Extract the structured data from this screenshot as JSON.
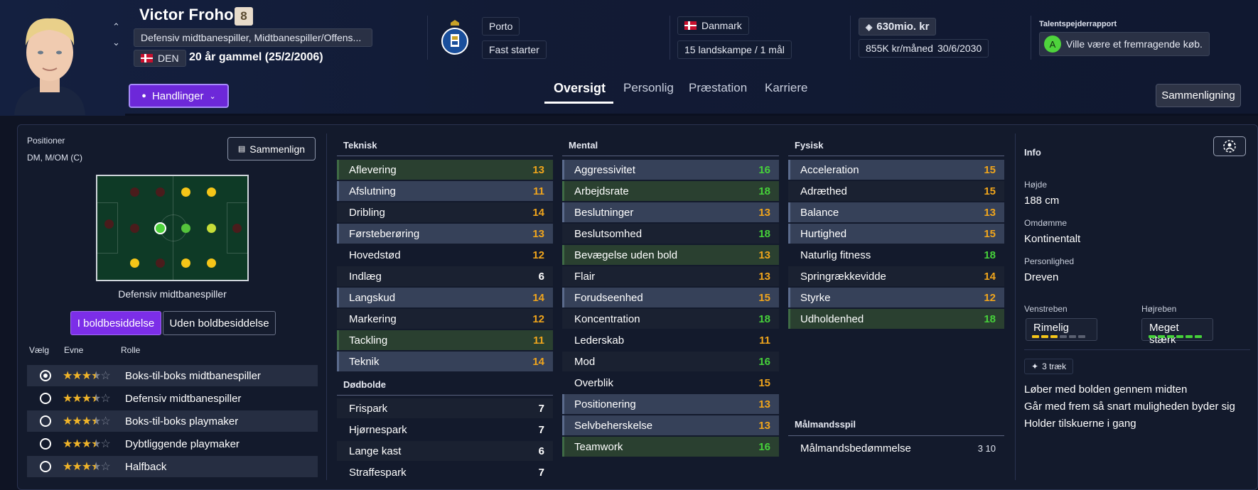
{
  "player": {
    "name": "Victor Froholdt",
    "squad_number": "8",
    "positions_text": "Defensiv midtbanespiller, Midtbanespiller/Offens...",
    "nationality_code": "DEN",
    "age_text": "20 år gammel (25/2/2006)"
  },
  "club": {
    "name": "Porto",
    "status": "Fast starter"
  },
  "nation": {
    "name": "Danmark",
    "caps": "15 landskampe / 1 mål"
  },
  "contract": {
    "value": "630mio. kr",
    "wage": "855K kr/måned",
    "expires": "30/6/2030"
  },
  "scout": {
    "title": "Talentspejderrapport",
    "grade": "A",
    "text": "Ville være et fremragende køb."
  },
  "actions_label": "Handlinger",
  "tabs": [
    {
      "label": "Oversigt",
      "active": true
    },
    {
      "label": "Personlig"
    },
    {
      "label": "Præstation"
    },
    {
      "label": "Karriere"
    }
  ],
  "compare_top_label": "Sammenligning",
  "positions": {
    "label": "Positioner",
    "value": "DM, M/OM (C)",
    "compare_label": "Sammenlign",
    "role_title": "Defensiv midtbanespiller",
    "toggle_on": "I boldbesiddelse",
    "toggle_off": "Uden boldbesiddelse"
  },
  "role_table": {
    "headers": [
      "Vælg",
      "Evne",
      "Rolle"
    ],
    "rows": [
      {
        "name": "Boks-til-boks midtbanespiller",
        "stars": 3.5,
        "selected": true
      },
      {
        "name": "Defensiv midtbanespiller",
        "stars": 3.5
      },
      {
        "name": "Boks-til-boks playmaker",
        "stars": 3.5
      },
      {
        "name": "Dybtliggende playmaker",
        "stars": 3.5
      },
      {
        "name": "Halfback",
        "stars": 3.5
      }
    ]
  },
  "teknisk": {
    "title": "Teknisk",
    "items": [
      {
        "name": "Aflevering",
        "value": "13"
      },
      {
        "name": "Afslutning",
        "value": "11"
      },
      {
        "name": "Dribling",
        "value": "14"
      },
      {
        "name": "Førsteberøring",
        "value": "13"
      },
      {
        "name": "Hovedstød",
        "value": "12"
      },
      {
        "name": "Indlæg",
        "value": "6"
      },
      {
        "name": "Langskud",
        "value": "14"
      },
      {
        "name": "Markering",
        "value": "12"
      },
      {
        "name": "Tackling",
        "value": "11"
      },
      {
        "name": "Teknik",
        "value": "14"
      }
    ]
  },
  "doedbolde": {
    "title": "Dødbolde",
    "items": [
      {
        "name": "Frispark",
        "value": "7"
      },
      {
        "name": "Hjørnespark",
        "value": "7"
      },
      {
        "name": "Lange kast",
        "value": "6"
      },
      {
        "name": "Straffespark",
        "value": "7"
      }
    ]
  },
  "mental": {
    "title": "Mental",
    "items": [
      {
        "name": "Aggressivitet",
        "value": "16"
      },
      {
        "name": "Arbejdsrate",
        "value": "18"
      },
      {
        "name": "Beslutninger",
        "value": "13"
      },
      {
        "name": "Beslutsomhed",
        "value": "18"
      },
      {
        "name": "Bevægelse uden bold",
        "value": "13"
      },
      {
        "name": "Flair",
        "value": "13"
      },
      {
        "name": "Forudseenhed",
        "value": "15"
      },
      {
        "name": "Koncentration",
        "value": "18"
      },
      {
        "name": "Lederskab",
        "value": "11"
      },
      {
        "name": "Mod",
        "value": "16"
      },
      {
        "name": "Overblik",
        "value": "15"
      },
      {
        "name": "Positionering",
        "value": "13"
      },
      {
        "name": "Selvbeherskelse",
        "value": "13"
      },
      {
        "name": "Teamwork",
        "value": "16"
      }
    ]
  },
  "fysisk": {
    "title": "Fysisk",
    "items": [
      {
        "name": "Acceleration",
        "value": "15"
      },
      {
        "name": "Adræthed",
        "value": "15"
      },
      {
        "name": "Balance",
        "value": "13"
      },
      {
        "name": "Hurtighed",
        "value": "15"
      },
      {
        "name": "Naturlig fitness",
        "value": "18"
      },
      {
        "name": "Springrækkevidde",
        "value": "14"
      },
      {
        "name": "Styrke",
        "value": "12"
      },
      {
        "name": "Udholdenhed",
        "value": "18"
      }
    ]
  },
  "goalkeeping": {
    "title": "Målmandsspil",
    "name": "Målmandsbedømmelse",
    "value": "3 10"
  },
  "info": {
    "title": "Info",
    "height_label": "Højde",
    "height": "188 cm",
    "reputation_label": "Omdømme",
    "reputation": "Kontinentalt",
    "personality_label": "Personlighed",
    "personality": "Dreven",
    "left_foot_label": "Venstreben",
    "left_foot": "Rimelig",
    "left_foot_level": 3,
    "right_foot_label": "Højreben",
    "right_foot": "Meget stærk",
    "right_foot_level": 6,
    "traits_label": "3 træk",
    "traits": [
      "Løber med bolden gennem midten",
      "Går med frem så snart muligheden byder sig",
      "Holder tilskuerne i gang"
    ]
  },
  "colors": {
    "accent": "#7c2ee8",
    "good": "#46d13a",
    "mid": "#f0a51c"
  }
}
